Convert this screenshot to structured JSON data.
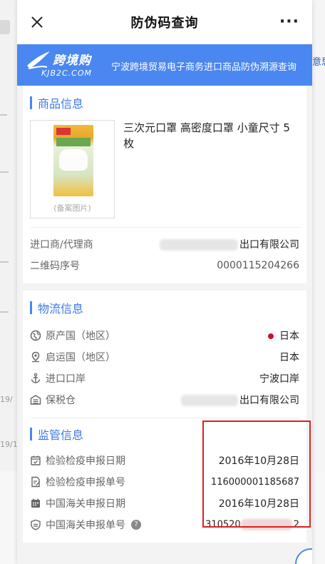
{
  "window": {
    "title": "防伪码查询"
  },
  "banner": {
    "logo_cn": "跨境购",
    "logo_en": "KJB2C.COM",
    "slogan": "宁波跨境贸易电子商务进口商品防伪溯源查询"
  },
  "background": {
    "right_tag": "意思",
    "left_dates": [
      "19/",
      "19/1"
    ]
  },
  "product": {
    "section_title": "商品信息",
    "name": "三次元口罩 高密度口罩 小童尺寸 5枚",
    "image_caption": "(备案图片)",
    "importer_label": "进口商/代理商",
    "importer_value": "出口有限公司",
    "qr_label": "二维码序号",
    "qr_value": "0000115204266"
  },
  "logistics": {
    "section_title": "物流信息",
    "origin_label": "原产国（地区）",
    "origin_value": "日本",
    "ship_label": "启运国（地区）",
    "ship_value": "日本",
    "port_label": "进口口岸",
    "port_value": "宁波口岸",
    "warehouse_label": "保税仓",
    "warehouse_value": "出口有限公司"
  },
  "supervision": {
    "section_title": "监管信息",
    "insp_date_label": "检验检疫申报日期",
    "insp_date_value": "2016年10月28日",
    "insp_no_label": "检验检疫申报单号",
    "insp_no_value": "116000001185687",
    "customs_date_label": "中国海关申报日期",
    "customs_date_value": "2016年10月28日",
    "customs_no_label": "中国海关申报单号",
    "customs_no_prefix": "310520",
    "customs_no_suffix": "2"
  },
  "colors": {
    "accent": "#4a87f0",
    "highlight_box": "#e02020"
  }
}
